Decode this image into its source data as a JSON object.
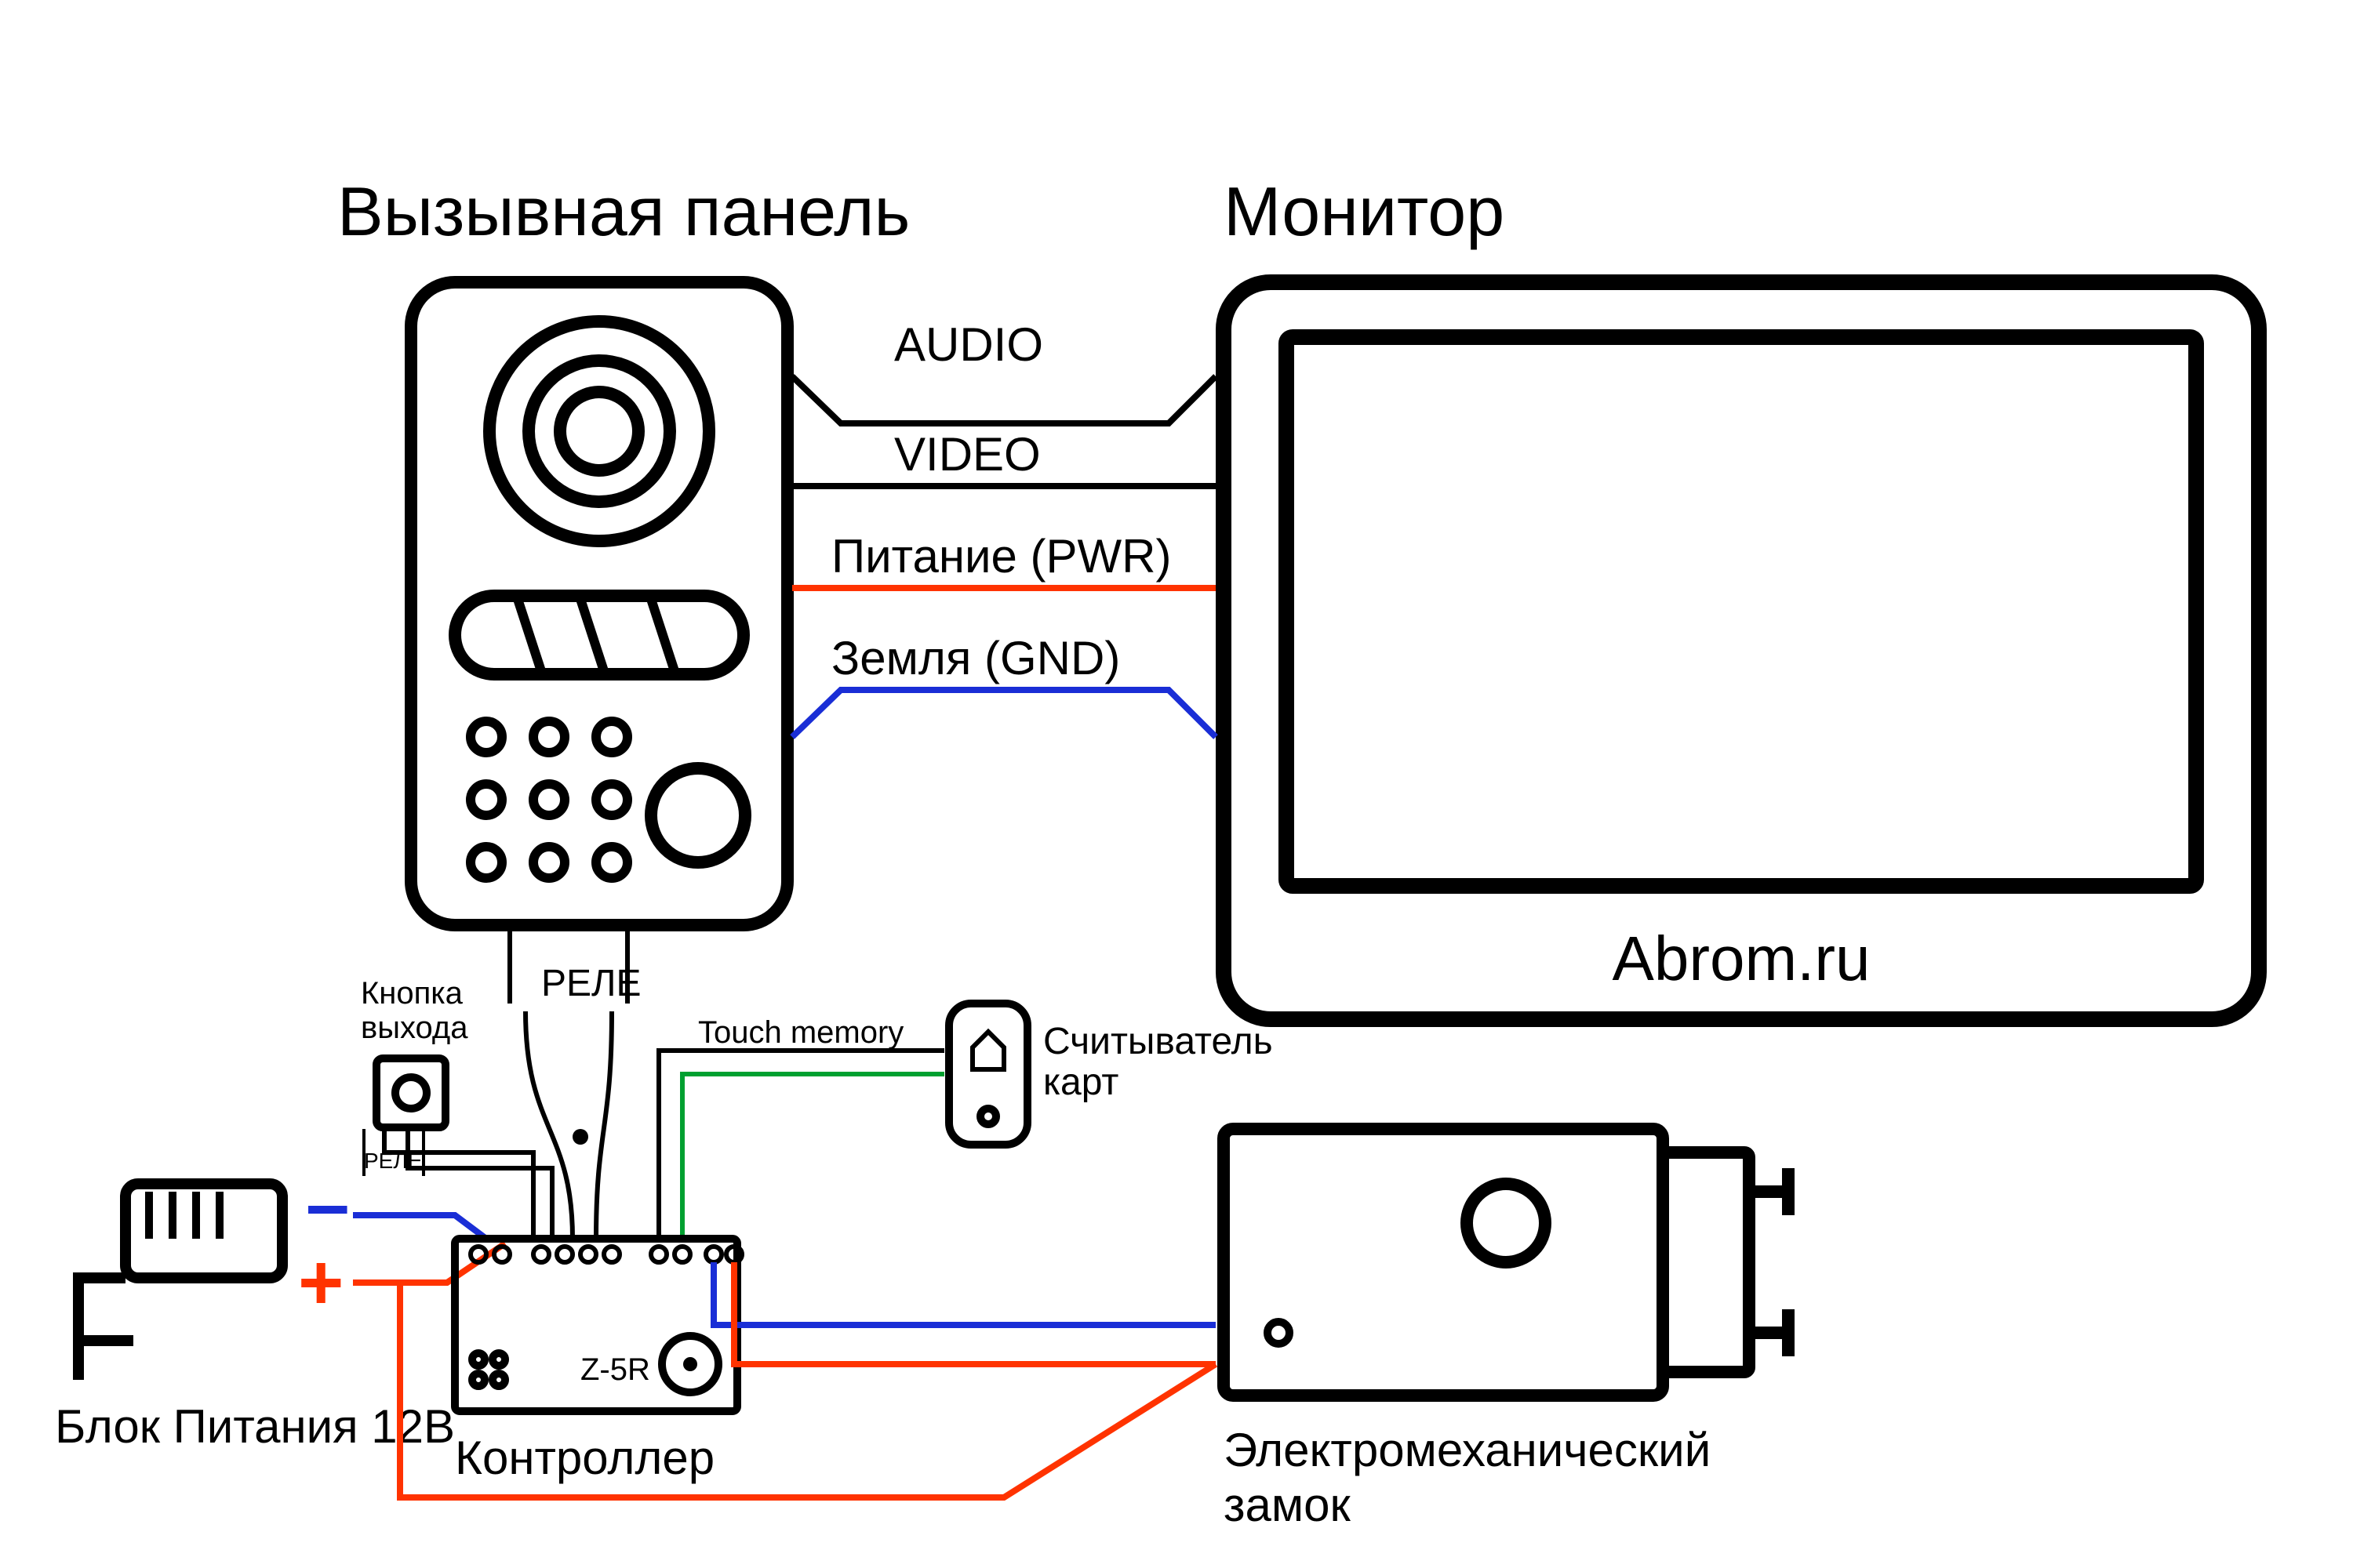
{
  "titles": {
    "callPanel": "Вызывная панель",
    "monitor": "Монитор",
    "brand": "Abrom.ru",
    "psu": "Блок Питания 12В",
    "controller": "Контроллер",
    "controllerModel": "Z-5R",
    "lock1": "Электромеханический",
    "lock2": "замок",
    "reader1": "Считыватель",
    "reader2": "карт",
    "exit1": "Кнопка",
    "exit2": "выхода"
  },
  "connections": {
    "audio": "AUDIO",
    "video": "VIDEO",
    "power": "Питание (PWR)",
    "ground": "Земля (GND)",
    "relay": "РЕЛЕ",
    "touch": "Touch memory"
  },
  "symbols": {
    "plus": "+",
    "minus": "–"
  },
  "colors": {
    "black": "#000000",
    "red": "#ff3300",
    "blue": "#1a2ed6",
    "green": "#00a030"
  }
}
